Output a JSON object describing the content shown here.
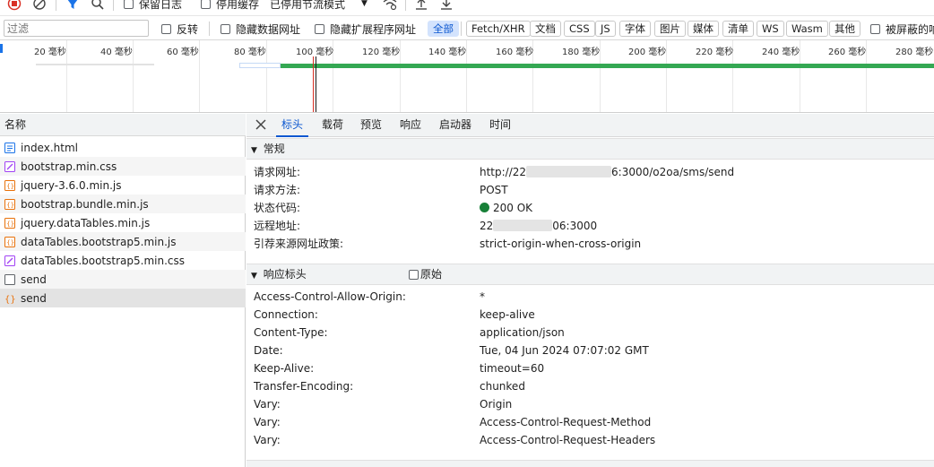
{
  "toolbar": {
    "preserve_log_label": "保留日志",
    "disable_cache_label": "停用缓存",
    "throttle_value": "已停用节流模式"
  },
  "filter_bar": {
    "filter_placeholder": "过滤",
    "invert_label": "反转",
    "hide_data_urls_label": "隐藏数据网址",
    "hide_extension_urls_label": "隐藏扩展程序网址",
    "type_chips": [
      "全部",
      "Fetch/XHR",
      "文档",
      "CSS",
      "JS",
      "字体",
      "图片",
      "媒体",
      "清单",
      "WS",
      "Wasm",
      "其他"
    ],
    "blocked_label": "被屏蔽的响应"
  },
  "overview": {
    "ticks": [
      "20 毫秒",
      "40 毫秒",
      "60 毫秒",
      "80 毫秒",
      "100 毫秒",
      "120 毫秒",
      "140 毫秒",
      "160 毫秒",
      "180 毫秒",
      "200 毫秒",
      "220 毫秒",
      "240 毫秒",
      "260 毫秒",
      "280 毫秒"
    ],
    "colors": {
      "waiting": "#34a853",
      "queue": "#c5d9f5",
      "marker_red": "#d93025",
      "marker_blue": "#1a73e8"
    }
  },
  "request_list": {
    "header": "名称",
    "rows": [
      {
        "name": "index.html",
        "icon": "document-icon"
      },
      {
        "name": "bootstrap.min.css",
        "icon": "stylesheet-icon"
      },
      {
        "name": "jquery-3.6.0.min.js",
        "icon": "script-icon"
      },
      {
        "name": "bootstrap.bundle.min.js",
        "icon": "script-icon"
      },
      {
        "name": "jquery.dataTables.min.js",
        "icon": "script-icon"
      },
      {
        "name": "dataTables.bootstrap5.min.js",
        "icon": "script-icon"
      },
      {
        "name": "dataTables.bootstrap5.min.css",
        "icon": "stylesheet-icon"
      },
      {
        "name": "send",
        "icon": "blank-icon"
      },
      {
        "name": "send",
        "icon": "fetch-icon"
      }
    ]
  },
  "details": {
    "tabs": [
      "标头",
      "载荷",
      "预览",
      "响应",
      "启动器",
      "时间"
    ],
    "general": {
      "title": "常规",
      "request_url_key": "请求网址:",
      "request_url_prefix": "http://22",
      "request_url_suffix": "6:3000/o2oa/sms/send",
      "method_key": "请求方法:",
      "method_value": "POST",
      "status_key": "状态代码:",
      "status_value": "200 OK",
      "status_color": "#188038",
      "remote_key": "远程地址:",
      "remote_prefix": "22",
      "remote_suffix": "06:3000",
      "referrer_key": "引荐来源网址政策:",
      "referrer_value": "strict-origin-when-cross-origin"
    },
    "response_headers": {
      "title": "响应标头",
      "raw_label": "原始",
      "rows": [
        {
          "key": "Access-Control-Allow-Origin:",
          "value": "*"
        },
        {
          "key": "Connection:",
          "value": "keep-alive"
        },
        {
          "key": "Content-Type:",
          "value": "application/json"
        },
        {
          "key": "Date:",
          "value": "Tue, 04 Jun 2024 07:07:02 GMT"
        },
        {
          "key": "Keep-Alive:",
          "value": "timeout=60"
        },
        {
          "key": "Transfer-Encoding:",
          "value": "chunked"
        },
        {
          "key": "Vary:",
          "value": "Origin"
        },
        {
          "key": "Vary:",
          "value": "Access-Control-Request-Method"
        },
        {
          "key": "Vary:",
          "value": "Access-Control-Request-Headers"
        }
      ]
    }
  }
}
